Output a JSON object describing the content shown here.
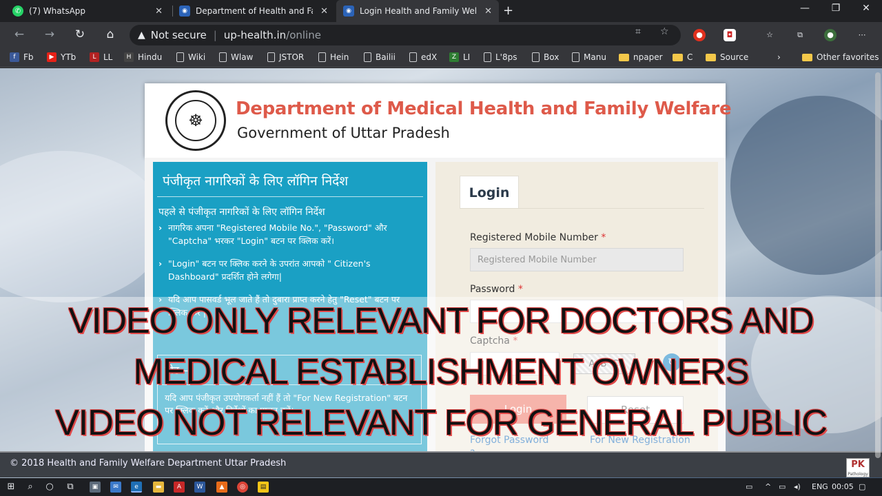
{
  "browser": {
    "tabs": [
      {
        "title": "(7) WhatsApp",
        "icon": "whatsapp-icon"
      },
      {
        "title": "Department of Health and Family",
        "icon": "up-govt-icon"
      },
      {
        "title": "Login Health and Family Welfare",
        "icon": "up-govt-icon",
        "active": true
      }
    ],
    "address": {
      "security_label": "Not secure",
      "host": "up-health.in",
      "path": "/online"
    },
    "bookmarks": [
      {
        "label": "Fb",
        "icon": "facebook-icon",
        "color": "#3b5998"
      },
      {
        "label": "YTb",
        "icon": "youtube-icon",
        "color": "#e62117"
      },
      {
        "label": "LL",
        "icon": "livelaw-icon",
        "color": "#b22222"
      },
      {
        "label": "Hindu",
        "icon": "hindu-icon",
        "color": "#444444"
      },
      {
        "label": "Wiki",
        "icon": "page-icon"
      },
      {
        "label": "Wlaw",
        "icon": "page-icon"
      },
      {
        "label": "JSTOR",
        "icon": "page-icon"
      },
      {
        "label": "Hein",
        "icon": "page-icon"
      },
      {
        "label": "Bailii",
        "icon": "page-icon"
      },
      {
        "label": "edX",
        "icon": "page-icon"
      },
      {
        "label": "LI",
        "icon": "li-icon",
        "color": "#2e7d32"
      },
      {
        "label": "L'8ps",
        "icon": "page-icon"
      },
      {
        "label": "Box",
        "icon": "page-icon"
      },
      {
        "label": "Manu",
        "icon": "page-icon"
      },
      {
        "label": "npaper",
        "icon": "folder-icon"
      },
      {
        "label": "C",
        "icon": "folder-icon"
      },
      {
        "label": "Source",
        "icon": "folder-icon"
      }
    ],
    "other_favorites": "Other favorites"
  },
  "page": {
    "dept_title": "Department of Medical Health and Family Welfare",
    "dept_subtitle": "Government of Uttar Pradesh",
    "instructions": {
      "heading": "पंजीकृत नागरिकों के लिए लॉगिन निर्देश",
      "subheading": "पहले से पंजीकृत नागरिकों के लिए लॉगिन निर्देश",
      "items": [
        "नागरिक अपना \"Registered Mobile No.\", \"Password\" और \"Captcha\" भरकर \"Login\" बटन पर क्लिक करें।",
        "\"Login\" बटन पर क्लिक करने के उपरांत आपको \" Citizen's Dashboard\" प्रदर्शित होने लगेगा|",
        "यदि आप पासवर्ड भूल जाते हैं तो दुबारा प्राप्त करने हेतु \"Reset\" बटन पर क्लिक करें |"
      ],
      "note_heading": "नोट –",
      "note_text": "यदि आप पंजीकृत उपयोगकर्ता नहीं हैं तो \"For New Registration\" बटन पर क्लिक करें और निर्देशों का पालन करें।"
    },
    "login": {
      "tab_label": "Login",
      "mobile_label": "Registered Mobile Number",
      "mobile_placeholder": "Registered Mobile Number",
      "password_label": "Password",
      "captcha_label": "Captcha",
      "captcha_text": "A B C",
      "required_mark": "*",
      "login_button": "Login",
      "reset_button": "Reset",
      "forgot_link": "Forgot Password",
      "forgot_q": "?",
      "register_link": "For New Registration"
    },
    "footer": "© 2018 Health and Family Welfare Department Uttar Pradesh",
    "watermark": {
      "logo": "PK",
      "sub": "Pathology"
    }
  },
  "overlay": {
    "line1": "VIDEO ONLY RELEVANT FOR DOCTORS AND",
    "line2": "MEDICAL ESTABLISHMENT OWNERS",
    "line3": "VIDEO NOT RELEVANT FOR GENERAL PUBLIC"
  },
  "taskbar": {
    "lang": "ENG",
    "time": "00:05"
  }
}
